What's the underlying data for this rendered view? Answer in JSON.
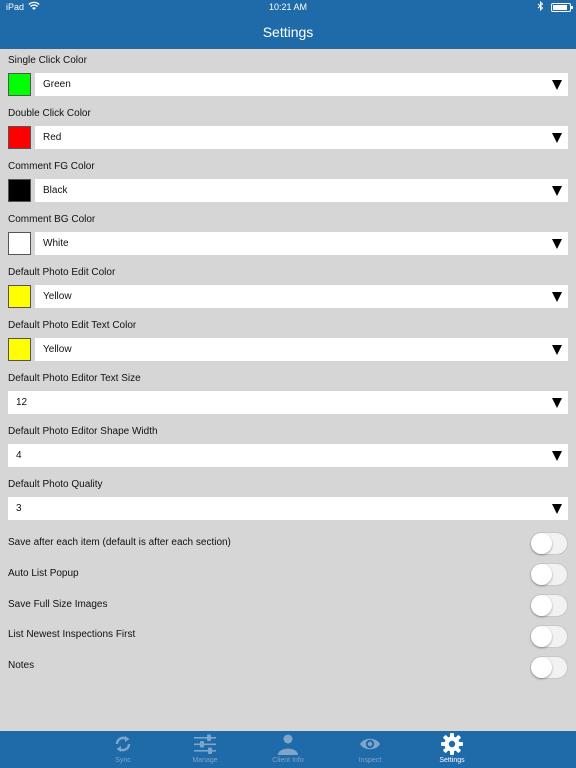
{
  "status_bar": {
    "carrier": "iPad",
    "time": "10:21 AM"
  },
  "nav": {
    "title": "Settings"
  },
  "color_settings": [
    {
      "label": "Single Click Color",
      "value": "Green",
      "swatch": "#00ff00"
    },
    {
      "label": "Double Click Color",
      "value": "Red",
      "swatch": "#ff0000"
    },
    {
      "label": "Comment FG Color",
      "value": "Black",
      "swatch": "#000000"
    },
    {
      "label": "Comment BG Color",
      "value": "White",
      "swatch": "#ffffff"
    },
    {
      "label": "Default Photo Edit Color",
      "value": "Yellow",
      "swatch": "#ffff00"
    },
    {
      "label": "Default Photo Edit Text Color",
      "value": "Yellow",
      "swatch": "#ffff00"
    }
  ],
  "value_settings": [
    {
      "label": "Default Photo Editor Text Size",
      "value": "12"
    },
    {
      "label": "Default Photo Editor Shape Width",
      "value": "4"
    },
    {
      "label": "Default Photo Quality",
      "value": "3"
    }
  ],
  "toggles": [
    {
      "label": "Save after each item (default is after each section)",
      "on": false
    },
    {
      "label": "Auto List Popup",
      "on": false
    },
    {
      "label": "Save Full Size Images",
      "on": false
    },
    {
      "label": "List Newest Inspections First",
      "on": false
    },
    {
      "label": "Notes",
      "on": false
    }
  ],
  "tabs": [
    {
      "label": "Sync",
      "icon": "sync-icon",
      "active": false
    },
    {
      "label": "Manage",
      "icon": "sliders-icon",
      "active": false
    },
    {
      "label": "Client Info",
      "icon": "person-icon",
      "active": false
    },
    {
      "label": "Inspect",
      "icon": "eye-icon",
      "active": false
    },
    {
      "label": "Settings",
      "icon": "gear-icon",
      "active": true
    }
  ],
  "colors": {
    "brand_blue": "#1f6aa9",
    "tab_inactive": "#7fa6c9",
    "background": "#d6d6d6"
  }
}
